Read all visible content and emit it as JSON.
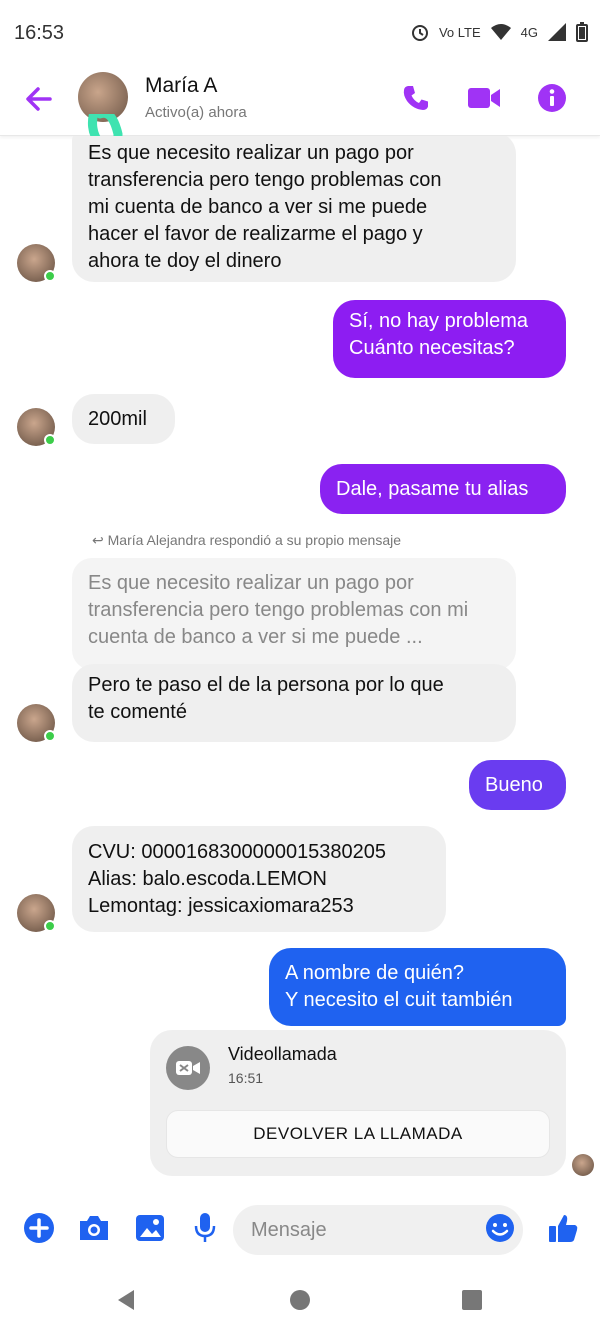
{
  "status_bar": {
    "time": "16:53",
    "network_label": "Vo LTE",
    "gen_label": "4G"
  },
  "header": {
    "name": "María A",
    "status": "Activo(a) ahora"
  },
  "messages": [
    {
      "text": "Es que necesito realizar un pago por\ntransferencia pero tengo problemas con\nmi cuenta de banco a ver si me puede\nhacer el favor de realizarme el pago y\nahora te doy el dinero"
    },
    {
      "text": "Sí, no hay problema\nCuánto necesitas?"
    },
    {
      "text": "200mil"
    },
    {
      "text": "Dale, pasame tu alias"
    },
    {
      "text": "Pero te paso el de la persona por lo que\nte comenté"
    },
    {
      "text": "Bueno"
    },
    {
      "text": "CVU: 0000168300000015380205\nAlias: balo.escoda.LEMON\nLemontag: jessicaxiomara253"
    },
    {
      "text": "A nombre de quién?\nY necesito el cuit también"
    }
  ],
  "reply": {
    "note": "María Alejandra respondió a su propio mensaje",
    "quoted_text": "Es que necesito realizar un pago por\ntransferencia pero tengo problemas con\nmi cuenta de banco a ver si me puede ..."
  },
  "call": {
    "title": "Videollamada",
    "time": "16:51",
    "button_label": "DEVOLVER LA LLAMADA"
  },
  "composer": {
    "placeholder": "Mensaje"
  },
  "colors": {
    "accent": "#a033f5",
    "purple_bubble": "#8d1df2",
    "mid_bubble": "#6a3cf0",
    "blue_bubble": "#1f62f0",
    "composer_icons": "#1f62f0",
    "online": "#3ccd4a"
  },
  "icons": [
    "back-arrow-icon",
    "phone-icon",
    "video-icon",
    "info-icon",
    "plus-icon",
    "camera-icon",
    "gallery-icon",
    "mic-icon",
    "emoji-icon",
    "thumbs-up-icon",
    "video-off-icon",
    "android-back-icon",
    "android-home-icon",
    "android-recents-icon"
  ]
}
